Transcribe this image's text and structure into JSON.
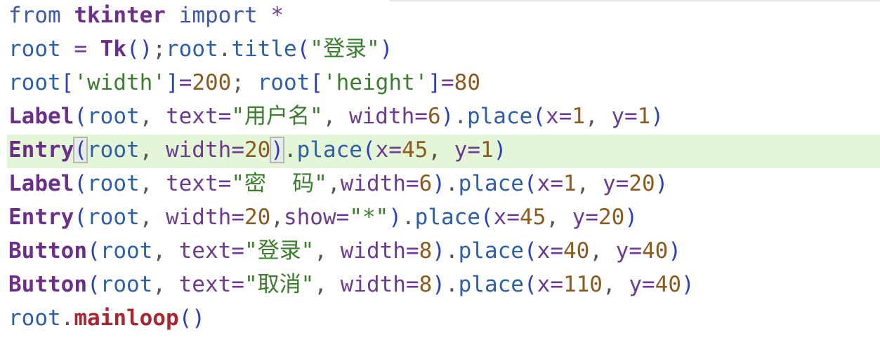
{
  "editor": {
    "lines": [
      {
        "tokens": [
          {
            "t": "from",
            "c": "kw"
          },
          {
            "t": " ",
            "c": "ident"
          },
          {
            "t": "tkinter",
            "c": "cls"
          },
          {
            "t": " ",
            "c": "ident"
          },
          {
            "t": "import",
            "c": "kw"
          },
          {
            "t": " ",
            "c": "ident"
          },
          {
            "t": "*",
            "c": "op"
          }
        ]
      },
      {
        "tokens": [
          {
            "t": "root",
            "c": "ident"
          },
          {
            "t": " ",
            "c": "ident"
          },
          {
            "t": "=",
            "c": "op"
          },
          {
            "t": " ",
            "c": "ident"
          },
          {
            "t": "Tk",
            "c": "cls"
          },
          {
            "t": "()",
            "c": "paren"
          },
          {
            "t": ";",
            "c": "punc"
          },
          {
            "t": "root",
            "c": "ident"
          },
          {
            "t": ".",
            "c": "punc"
          },
          {
            "t": "title",
            "c": "ident"
          },
          {
            "t": "(",
            "c": "paren"
          },
          {
            "t": "\"登录\"",
            "c": "str"
          },
          {
            "t": ")",
            "c": "paren"
          }
        ]
      },
      {
        "tokens": [
          {
            "t": "root",
            "c": "ident"
          },
          {
            "t": "[",
            "c": "paren"
          },
          {
            "t": "'width'",
            "c": "str"
          },
          {
            "t": "]",
            "c": "paren"
          },
          {
            "t": "=",
            "c": "op"
          },
          {
            "t": "200",
            "c": "num"
          },
          {
            "t": ";",
            "c": "punc"
          },
          {
            "t": " ",
            "c": "ident"
          },
          {
            "t": "root",
            "c": "ident"
          },
          {
            "t": "[",
            "c": "paren"
          },
          {
            "t": "'height'",
            "c": "str"
          },
          {
            "t": "]",
            "c": "paren"
          },
          {
            "t": "=",
            "c": "op"
          },
          {
            "t": "80",
            "c": "num"
          }
        ]
      },
      {
        "tokens": [
          {
            "t": "Label",
            "c": "cls"
          },
          {
            "t": "(",
            "c": "paren"
          },
          {
            "t": "root",
            "c": "ident"
          },
          {
            "t": ", ",
            "c": "punc"
          },
          {
            "t": "text",
            "c": "param"
          },
          {
            "t": "=",
            "c": "op"
          },
          {
            "t": "\"用户名\"",
            "c": "str"
          },
          {
            "t": ", ",
            "c": "punc"
          },
          {
            "t": "width",
            "c": "param"
          },
          {
            "t": "=",
            "c": "op"
          },
          {
            "t": "6",
            "c": "num"
          },
          {
            "t": ")",
            "c": "paren"
          },
          {
            "t": ".",
            "c": "punc"
          },
          {
            "t": "place",
            "c": "ident"
          },
          {
            "t": "(",
            "c": "paren"
          },
          {
            "t": "x",
            "c": "param"
          },
          {
            "t": "=",
            "c": "op"
          },
          {
            "t": "1",
            "c": "num"
          },
          {
            "t": ", ",
            "c": "punc"
          },
          {
            "t": "y",
            "c": "param"
          },
          {
            "t": "=",
            "c": "op"
          },
          {
            "t": "1",
            "c": "num"
          },
          {
            "t": ")",
            "c": "paren"
          }
        ]
      },
      {
        "highlight": true,
        "tokens": [
          {
            "t": "Entry",
            "c": "cls"
          },
          {
            "t": "(",
            "c": "paren",
            "match": true
          },
          {
            "t": "root",
            "c": "ident"
          },
          {
            "t": ", ",
            "c": "punc"
          },
          {
            "t": "width",
            "c": "param"
          },
          {
            "t": "=",
            "c": "op"
          },
          {
            "t": "20",
            "c": "num"
          },
          {
            "t": ")",
            "c": "paren",
            "match": true
          },
          {
            "t": ".",
            "c": "punc"
          },
          {
            "t": "place",
            "c": "ident"
          },
          {
            "t": "(",
            "c": "paren"
          },
          {
            "t": "x",
            "c": "param"
          },
          {
            "t": "=",
            "c": "op"
          },
          {
            "t": "45",
            "c": "num"
          },
          {
            "t": ", ",
            "c": "punc"
          },
          {
            "t": "y",
            "c": "param"
          },
          {
            "t": "=",
            "c": "op"
          },
          {
            "t": "1",
            "c": "num"
          },
          {
            "t": ")",
            "c": "paren"
          }
        ]
      },
      {
        "tokens": [
          {
            "t": "Label",
            "c": "cls"
          },
          {
            "t": "(",
            "c": "paren"
          },
          {
            "t": "root",
            "c": "ident"
          },
          {
            "t": ", ",
            "c": "punc"
          },
          {
            "t": "text",
            "c": "param"
          },
          {
            "t": "=",
            "c": "op"
          },
          {
            "t": "\"密  码\"",
            "c": "str"
          },
          {
            "t": ",",
            "c": "punc"
          },
          {
            "t": "width",
            "c": "param"
          },
          {
            "t": "=",
            "c": "op"
          },
          {
            "t": "6",
            "c": "num"
          },
          {
            "t": ")",
            "c": "paren"
          },
          {
            "t": ".",
            "c": "punc"
          },
          {
            "t": "place",
            "c": "ident"
          },
          {
            "t": "(",
            "c": "paren"
          },
          {
            "t": "x",
            "c": "param"
          },
          {
            "t": "=",
            "c": "op"
          },
          {
            "t": "1",
            "c": "num"
          },
          {
            "t": ", ",
            "c": "punc"
          },
          {
            "t": "y",
            "c": "param"
          },
          {
            "t": "=",
            "c": "op"
          },
          {
            "t": "20",
            "c": "num"
          },
          {
            "t": ")",
            "c": "paren"
          }
        ]
      },
      {
        "tokens": [
          {
            "t": "Entry",
            "c": "cls"
          },
          {
            "t": "(",
            "c": "paren"
          },
          {
            "t": "root",
            "c": "ident"
          },
          {
            "t": ", ",
            "c": "punc"
          },
          {
            "t": "width",
            "c": "param"
          },
          {
            "t": "=",
            "c": "op"
          },
          {
            "t": "20",
            "c": "num"
          },
          {
            "t": ",",
            "c": "punc"
          },
          {
            "t": "show",
            "c": "param"
          },
          {
            "t": "=",
            "c": "op"
          },
          {
            "t": "\"*\"",
            "c": "str"
          },
          {
            "t": ")",
            "c": "paren"
          },
          {
            "t": ".",
            "c": "punc"
          },
          {
            "t": "place",
            "c": "ident"
          },
          {
            "t": "(",
            "c": "paren"
          },
          {
            "t": "x",
            "c": "param"
          },
          {
            "t": "=",
            "c": "op"
          },
          {
            "t": "45",
            "c": "num"
          },
          {
            "t": ", ",
            "c": "punc"
          },
          {
            "t": "y",
            "c": "param"
          },
          {
            "t": "=",
            "c": "op"
          },
          {
            "t": "20",
            "c": "num"
          },
          {
            "t": ")",
            "c": "paren"
          }
        ]
      },
      {
        "tokens": [
          {
            "t": "Button",
            "c": "cls"
          },
          {
            "t": "(",
            "c": "paren"
          },
          {
            "t": "root",
            "c": "ident"
          },
          {
            "t": ", ",
            "c": "punc"
          },
          {
            "t": "text",
            "c": "param"
          },
          {
            "t": "=",
            "c": "op"
          },
          {
            "t": "\"登录\"",
            "c": "str"
          },
          {
            "t": ", ",
            "c": "punc"
          },
          {
            "t": "width",
            "c": "param"
          },
          {
            "t": "=",
            "c": "op"
          },
          {
            "t": "8",
            "c": "num"
          },
          {
            "t": ")",
            "c": "paren"
          },
          {
            "t": ".",
            "c": "punc"
          },
          {
            "t": "place",
            "c": "ident"
          },
          {
            "t": "(",
            "c": "paren"
          },
          {
            "t": "x",
            "c": "param"
          },
          {
            "t": "=",
            "c": "op"
          },
          {
            "t": "40",
            "c": "num"
          },
          {
            "t": ", ",
            "c": "punc"
          },
          {
            "t": "y",
            "c": "param"
          },
          {
            "t": "=",
            "c": "op"
          },
          {
            "t": "40",
            "c": "num"
          },
          {
            "t": ")",
            "c": "paren"
          }
        ]
      },
      {
        "tokens": [
          {
            "t": "Button",
            "c": "cls"
          },
          {
            "t": "(",
            "c": "paren"
          },
          {
            "t": "root",
            "c": "ident"
          },
          {
            "t": ", ",
            "c": "punc"
          },
          {
            "t": "text",
            "c": "param"
          },
          {
            "t": "=",
            "c": "op"
          },
          {
            "t": "\"取消\"",
            "c": "str"
          },
          {
            "t": ", ",
            "c": "punc"
          },
          {
            "t": "width",
            "c": "param"
          },
          {
            "t": "=",
            "c": "op"
          },
          {
            "t": "8",
            "c": "num"
          },
          {
            "t": ")",
            "c": "paren"
          },
          {
            "t": ".",
            "c": "punc"
          },
          {
            "t": "place",
            "c": "ident"
          },
          {
            "t": "(",
            "c": "paren"
          },
          {
            "t": "x",
            "c": "param"
          },
          {
            "t": "=",
            "c": "op"
          },
          {
            "t": "110",
            "c": "num"
          },
          {
            "t": ", ",
            "c": "punc"
          },
          {
            "t": "y",
            "c": "param"
          },
          {
            "t": "=",
            "c": "op"
          },
          {
            "t": "40",
            "c": "num"
          },
          {
            "t": ")",
            "c": "paren"
          }
        ]
      },
      {
        "tokens": [
          {
            "t": "root",
            "c": "ident"
          },
          {
            "t": ".",
            "c": "punc"
          },
          {
            "t": "mainloop",
            "c": "fn"
          },
          {
            "t": "()",
            "c": "paren"
          }
        ]
      }
    ]
  }
}
